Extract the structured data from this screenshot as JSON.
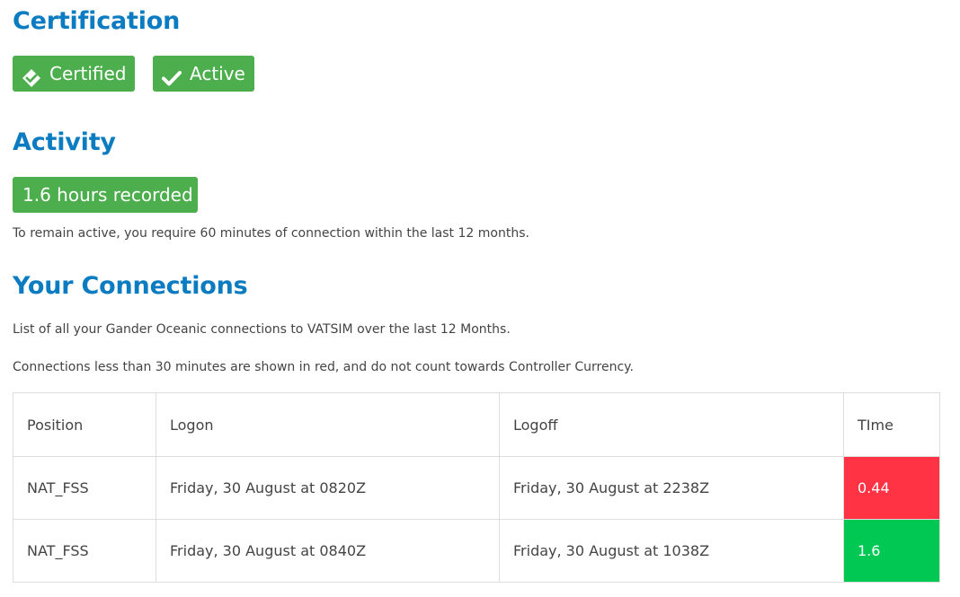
{
  "certification": {
    "heading": "Certification",
    "certified_label": "Certified",
    "certified_icon": "double-check-icon",
    "active_label": "Active",
    "active_icon": "check-icon",
    "badge_color": "#4cae4c"
  },
  "activity": {
    "heading": "Activity",
    "hours_badge": "1.6 hours recorded",
    "requirement_text": "To remain active, you require 60 minutes of connection within the last 12 months."
  },
  "connections": {
    "heading": "Your Connections",
    "description": "List of all your Gander Oceanic connections to VATSIM over the last 12 Months.",
    "note": "Connections less than 30 minutes are shown in red, and do not count towards Controller Currency.",
    "columns": [
      "Position",
      "Logon",
      "Logoff",
      "TIme"
    ],
    "rows": [
      {
        "position": "NAT_FSS",
        "logon": "Friday, 30 August at 0820Z",
        "logoff": "Friday, 30 August at 2238Z",
        "time": "0.44",
        "status_color": "#ff3344"
      },
      {
        "position": "NAT_FSS",
        "logon": "Friday, 30 August at 0840Z",
        "logoff": "Friday, 30 August at 1038Z",
        "time": "1.6",
        "status_color": "#00c853"
      }
    ]
  }
}
